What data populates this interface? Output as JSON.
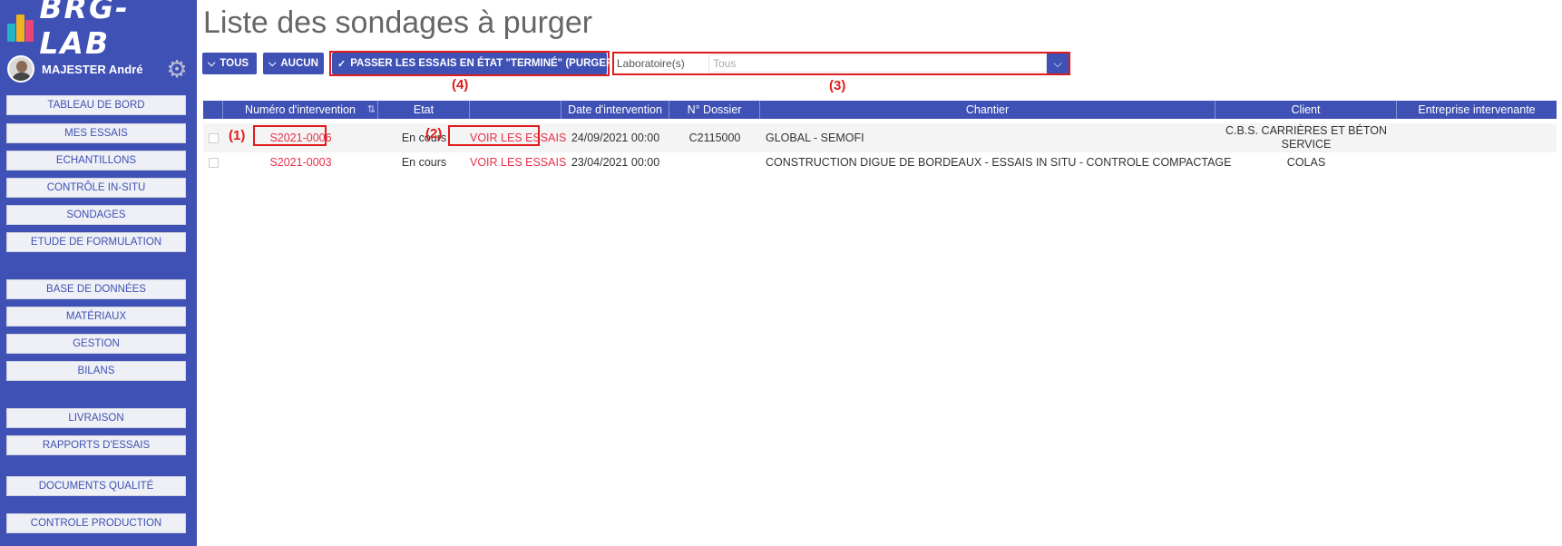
{
  "app": {
    "logo_text": "BRG-LAB",
    "user_name": "MAJESTER André",
    "colors": {
      "primary": "#3f51b5",
      "annotation": "#e01b1b",
      "link": "#e8314a"
    }
  },
  "sidebar": {
    "items": [
      {
        "label": "TABLEAU DE BORD"
      },
      {
        "label": "MES ESSAIS"
      },
      {
        "label": "ECHANTILLONS"
      },
      {
        "label": "CONTRÔLE IN-SITU"
      },
      {
        "label": "SONDAGES"
      },
      {
        "label": "ETUDE DE FORMULATION"
      },
      {
        "label": "BASE DE DONNÉES"
      },
      {
        "label": "MATÉRIAUX"
      },
      {
        "label": "GESTION"
      },
      {
        "label": "BILANS"
      },
      {
        "label": "LIVRAISON"
      },
      {
        "label": "RAPPORTS D'ESSAIS"
      },
      {
        "label": "DOCUMENTS QUALITÉ"
      },
      {
        "label": "CONTROLE PRODUCTION"
      }
    ]
  },
  "page": {
    "title": "Liste des sondages à purger"
  },
  "toolbar": {
    "all_label": "TOUS",
    "none_label": "AUCUN",
    "purge_label": "PASSER LES ESSAIS EN ÉTAT \"TERMINÉ\" (PURGER)",
    "lab_label": "Laboratoire(s)",
    "lab_value": "Tous"
  },
  "annotations": {
    "a1": "(1)",
    "a2": "(2)",
    "a3": "(3)",
    "a4": "(4)"
  },
  "table": {
    "headers": [
      "",
      "Numéro d'intervention",
      "Etat",
      "",
      "Date d'intervention",
      "N° Dossier",
      "Chantier",
      "Client",
      "Entreprise intervenante"
    ],
    "rows": [
      {
        "numero": "S2021-0006",
        "etat": "En cours",
        "action": "VOIR LES ESSAIS",
        "date": "24/09/2021 00:00",
        "dossier": "C2115000",
        "chantier": "GLOBAL - SEMOFI",
        "client_line1": "C.B.S. CARRIÈRES ET BÉTON",
        "client_line2": "SERVICE",
        "entreprise": ""
      },
      {
        "numero": "S2021-0003",
        "etat": "En cours",
        "action": "VOIR LES ESSAIS",
        "date": "23/04/2021 00:00",
        "dossier": "",
        "chantier": "CONSTRUCTION DIGUE DE BORDEAUX - ESSAIS IN SITU - CONTROLE COMPACTAGE",
        "client_line1": "COLAS",
        "client_line2": "",
        "entreprise": ""
      }
    ]
  }
}
